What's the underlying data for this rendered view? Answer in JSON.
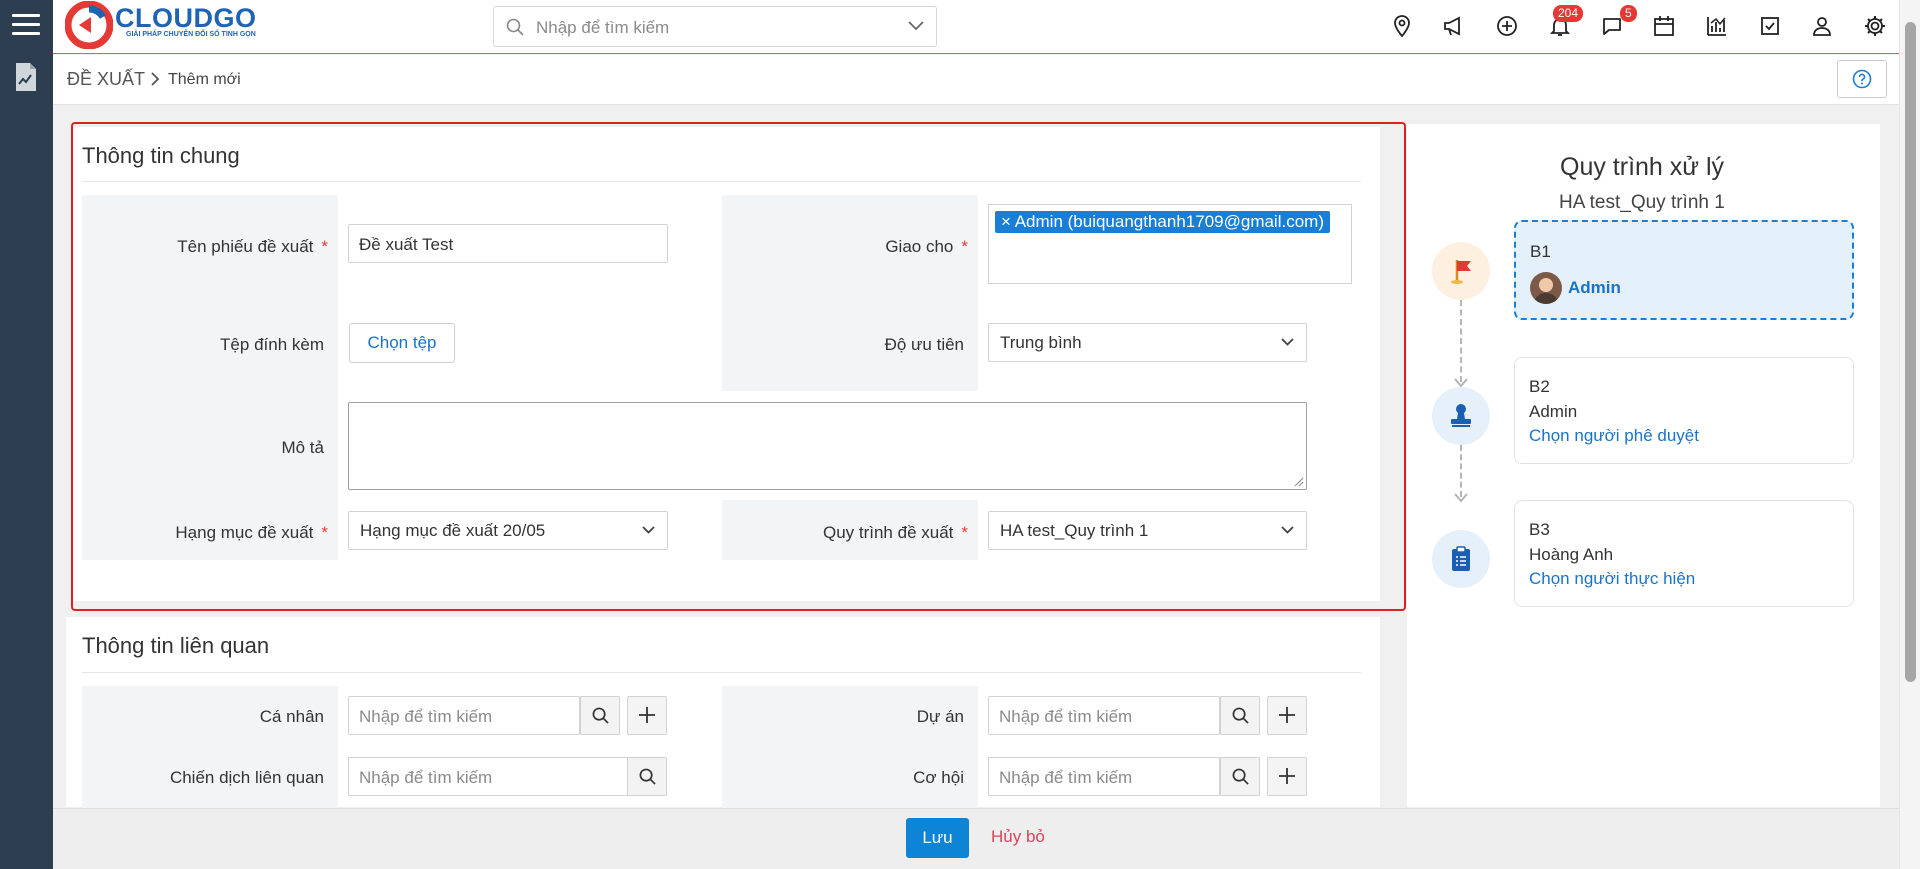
{
  "brand": {
    "name": "CLOUDGO",
    "tagline": "GIẢI PHÁP CHUYỂN ĐỔI SỐ TINH GỌN"
  },
  "search": {
    "placeholder": "Nhập để tìm kiếm"
  },
  "toolbar": {
    "notifications_count": "204",
    "messages_count": "5"
  },
  "breadcrumb": {
    "module": "ĐỀ XUẤT",
    "page": "Thêm mới"
  },
  "general": {
    "title": "Thông tin chung",
    "name_label": "Tên phiếu đề xuất",
    "name_value": "Đề xuất Test",
    "assign_label": "Giao cho",
    "assign_tag": "Admin (buiquangthanh1709@gmail.com)",
    "attach_label": "Tệp đính kèm",
    "attach_button": "Chọn tệp",
    "priority_label": "Độ ưu tiên",
    "priority_value": "Trung bình",
    "desc_label": "Mô tả",
    "category_label": "Hạng mục đề xuất",
    "category_value": "Hạng mục đề xuất 20/05",
    "process_label": "Quy trình đề xuất",
    "process_value": "HA test_Quy trình 1"
  },
  "related": {
    "title": "Thông tin liên quan",
    "person_label": "Cá nhân",
    "project_label": "Dự án",
    "campaign_label": "Chiến dịch liên quan",
    "opportunity_label": "Cơ hội",
    "placeholder": "Nhập để tìm kiếm"
  },
  "process": {
    "title": "Quy trình xử lý",
    "subtitle": "HA test_Quy trình 1",
    "steps": [
      {
        "code": "B1",
        "assignee": "Admin",
        "icon": "flag-icon"
      },
      {
        "code": "B2",
        "assignee": "Admin",
        "action": "Chọn người phê duyệt",
        "icon": "stamp-icon"
      },
      {
        "code": "B3",
        "assignee": "Hoàng Anh",
        "action": "Chọn người thực hiện",
        "icon": "clipboard-icon"
      }
    ]
  },
  "footer": {
    "save": "Lưu",
    "cancel": "Hủy bỏ"
  },
  "colors": {
    "primary": "#0d84d6",
    "sidebar": "#2c3e50",
    "highlight": "#e02020",
    "required": "#e53935"
  }
}
